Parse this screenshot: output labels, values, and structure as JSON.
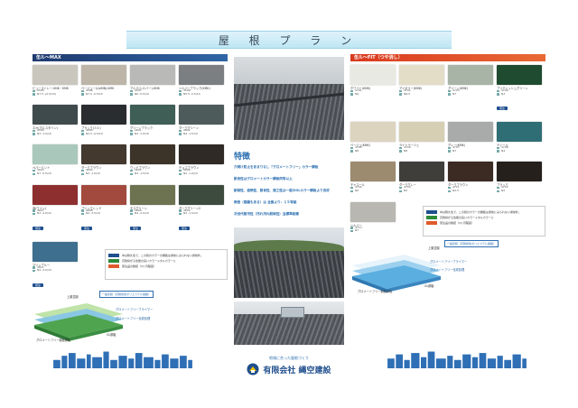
{
  "title": "屋 根 プ ラ ン",
  "left_section": {
    "label": "缶ル〜MAX",
    "colors": [
      {
        "name": "ビューストレー-KNK・KMK",
        "c": "#c9c7bd",
        "m1": "4595",
        "m2": "N7.5 -(2.5/10)",
        "badge": ""
      },
      {
        "name": "ベージュー(LA/MB)-KMK",
        "c": "#bdb6a8",
        "m1": "4596",
        "m2": "N7.5 -0.5/10",
        "badge": ""
      },
      {
        "name": "アルミ(シルバー)-KMK",
        "c": "#b9bab7",
        "m1": "4597",
        "m2": "N6 -0.5/10",
        "badge": ""
      },
      {
        "name": "シルバーブラック(KMK)",
        "c": "#7b7f82",
        "m1": "4598",
        "m2": "N5.5 -0.5/10",
        "badge": ""
      },
      {
        "name": "ネオ(ホルスタイン)",
        "c": "#3f4a4d",
        "m1": "4599",
        "m2": "N3 -1.0/10",
        "badge": ""
      },
      {
        "name": "ブラック(ミル)",
        "c": "#2a2d30",
        "m1": "4600",
        "m2": "N2.5 -0.5/10",
        "badge": ""
      },
      {
        "name": "グリーンブラック",
        "c": "#3f5e55",
        "m1": "4601",
        "m2": "N4 -1.0/10",
        "badge": ""
      },
      {
        "name": "ダークグリーン",
        "c": "#4e5b5b",
        "m1": "4602",
        "m2": "N4 -1.5/10",
        "badge": ""
      },
      {
        "name": "ペパーミント",
        "c": "#a9c8bb",
        "m1": "4603",
        "m2": "N7 -0.5/10",
        "badge": ""
      },
      {
        "name": "ダークブラウン",
        "c": "#44392f",
        "m1": "4604",
        "m2": "N3 -1.0/10",
        "badge": ""
      },
      {
        "name": "ウッドブラウン",
        "c": "#3c3428",
        "m1": "4605",
        "m2": "N3 -1.5/10",
        "badge": ""
      },
      {
        "name": "チョコブラウン",
        "c": "#2f2a25",
        "m1": "4606",
        "m2": "N2 -1.0/10",
        "badge": ""
      },
      {
        "name": "赤(ワイン)",
        "c": "#8e2f2f",
        "m1": "4607",
        "m2": "N3 -4.0/10",
        "badge": "受注"
      },
      {
        "name": "ブリックレッド",
        "c": "#a24a3d",
        "m1": "4608",
        "m2": "N4 -3.5/10",
        "badge": "受注"
      },
      {
        "name": "モスグリーン",
        "c": "#6d7251",
        "m1": "4609",
        "m2": "N4 -2.0/10",
        "badge": "受注"
      },
      {
        "name": "ダークグリーン2",
        "c": "#3d4b3f",
        "m1": "4610",
        "m2": "N3 -1.5/10",
        "badge": "受注"
      },
      {
        "name": "マリンブルー",
        "c": "#3e6f8f",
        "m1": "4611",
        "m2": "N4 -3.0/10",
        "badge": "受注"
      }
    ]
  },
  "right_section": {
    "label": "缶ル〜FIT（つや消し）",
    "colors": [
      {
        "name": "ホワイト(KMK)",
        "c": "#e9e9e4",
        "m1": "4701",
        "m2": "N9",
        "badge": ""
      },
      {
        "name": "アイボリー(KMK)",
        "c": "#e3ddc8",
        "m1": "4702",
        "m2": "N8.5",
        "badge": ""
      },
      {
        "name": "グリーン(KMK)",
        "c": "#a8b5a6",
        "m1": "4703",
        "m2": "N7",
        "badge": ""
      },
      {
        "name": "ブリティッシュグリーン",
        "c": "#1f4b30",
        "m1": "4704",
        "m2": "N3",
        "badge": "受注"
      },
      {
        "name": "ベージュ(KMK)",
        "c": "#ddd4bf",
        "m1": "4705",
        "m2": "N8",
        "badge": ""
      },
      {
        "name": "ライトベージュ",
        "c": "#d7cfb4",
        "m1": "4706",
        "m2": "N8",
        "badge": ""
      },
      {
        "name": "グレー(KMK)",
        "c": "#a9abaa",
        "m1": "4707",
        "m2": "N7",
        "badge": ""
      },
      {
        "name": "ティール",
        "c": "#2f6e74",
        "m1": "4708",
        "m2": "N4",
        "badge": ""
      },
      {
        "name": "チャコール",
        "c": "#9d8b6f",
        "m1": "4709",
        "m2": "N6",
        "badge": ""
      },
      {
        "name": "ダークグレー",
        "c": "#3f3e3b",
        "m1": "4710",
        "m2": "N3",
        "badge": ""
      },
      {
        "name": "ダークブラウン",
        "c": "#3b2b23",
        "m1": "4711",
        "m2": "N2.5",
        "badge": ""
      },
      {
        "name": "ブラック",
        "c": "#25201c",
        "m1": "4712",
        "m2": "N2",
        "badge": ""
      },
      {
        "name": "シルバー",
        "c": "#b8b7b1",
        "m1": "4713",
        "m2": "N7",
        "badge": ""
      }
    ]
  },
  "feature": {
    "title": "特徴",
    "lines": [
      "穴明け防止をあまりなし「グロメートフリー」カラー鋼板",
      "耐食性はグロメートカラー鋼板同等以上",
      "耐候性、遮熱性、耐食性、施工性は一般のGLカラー鋼板より良好",
      "雨音（風騒もある）は 全面より：１５等級",
      "次世代耐汚性（汚れ汚れ耐候性）当標準装備"
    ]
  },
  "notes": [
    {
      "tag": "b",
      "text": "中は耐久性で、この間のカラーの鋼板は通常にみられない通常外。"
    },
    {
      "tag": "g",
      "text": "高耐候がる性能の良いカラーメタルカラーに"
    },
    {
      "tag": "o",
      "text": "受注品の確認（3ヶ月程度）"
    }
  ],
  "diagram": {
    "layer1": "上層塗膜",
    "layer2": "一般塗膜（高耐候性ポリエステル樹脂）",
    "layer3": "グロメートフリーブライマー",
    "layer4": "グロメートフリー化成処理",
    "layer5": "GL鋼板",
    "base": "グロメートフリー鋼板原板"
  },
  "footer": {
    "tagline": "地域に合った屋根づくり",
    "company": "有限会社 縄空建設"
  }
}
